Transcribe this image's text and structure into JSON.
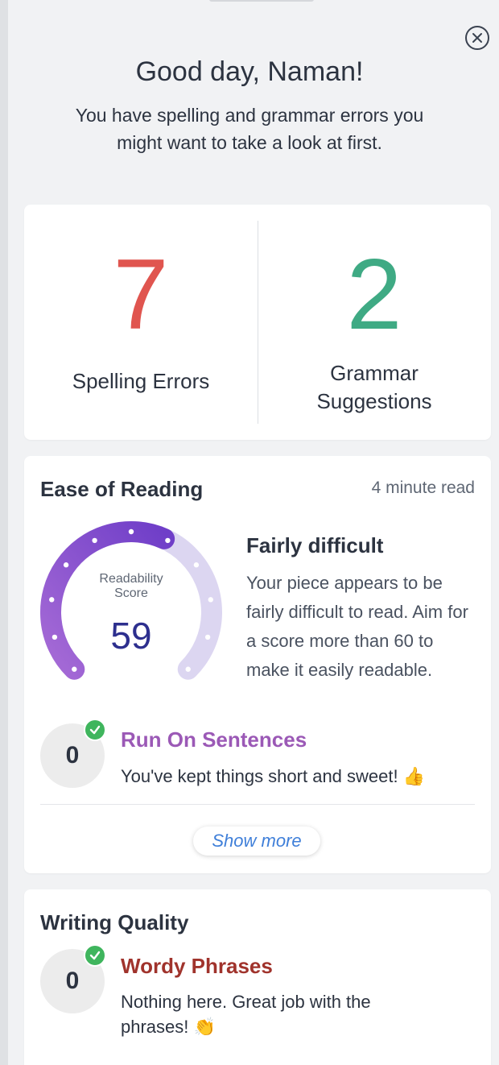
{
  "header": {
    "greeting": "Good day, Naman!",
    "subtitle": "You have spelling and grammar errors you might want to take a look at first."
  },
  "stats": {
    "spelling": {
      "count": "7",
      "label": "Spelling Errors",
      "color": "#e0554f"
    },
    "grammar": {
      "count": "2",
      "label_line1": "Grammar",
      "label_line2": "Suggestions",
      "color": "#3faa84"
    }
  },
  "ease_of_reading": {
    "title": "Ease of Reading",
    "read_time": "4 minute read",
    "gauge": {
      "label_line1": "Readability",
      "label_line2": "Score",
      "score": "59",
      "value": 59,
      "max": 100
    },
    "difficulty": {
      "title": "Fairly difficult",
      "description": "Your piece appears to be fairly difficult to read. Aim for a score more than 60 to make it easily readable."
    },
    "run_on": {
      "count": "0",
      "title": "Run On Sentences",
      "title_color": "#9b59b6",
      "description": "You've kept things short and sweet! 👍"
    },
    "show_more": "Show more"
  },
  "writing_quality": {
    "title": "Writing Quality",
    "wordy": {
      "count": "0",
      "title": "Wordy Phrases",
      "title_color": "#a0332c",
      "description": "Nothing here. Great job with the phrases! 👏"
    }
  },
  "icons": {
    "close": "close-icon",
    "check": "check-icon"
  }
}
